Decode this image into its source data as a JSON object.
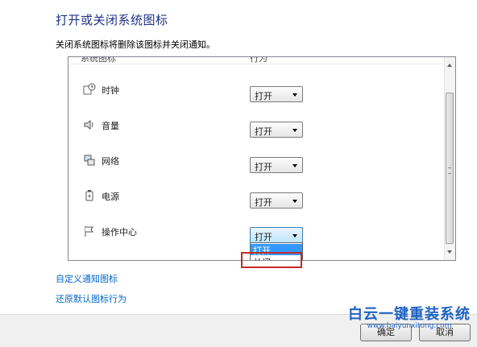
{
  "page": {
    "title": "打开或关闭系统图标",
    "description": "关闭系统图标将删除该图标并关闭通知。"
  },
  "table": {
    "headers": {
      "icon": "系统图标",
      "behavior": "行为"
    },
    "rows": [
      {
        "name": "时钟",
        "icon": "clock-icon",
        "value": "打开"
      },
      {
        "name": "音量",
        "icon": "speaker-icon",
        "value": "打开"
      },
      {
        "name": "网络",
        "icon": "network-icon",
        "value": "打开"
      },
      {
        "name": "电源",
        "icon": "power-icon",
        "value": "打开"
      },
      {
        "name": "操作中心",
        "icon": "flag-icon",
        "value": "打开"
      }
    ]
  },
  "dropdown": {
    "options": [
      "打开",
      "关闭"
    ],
    "selected": "打开"
  },
  "links": {
    "customize": "自定义通知图标",
    "restore": "还原默认图标行为"
  },
  "buttons": {
    "ok": "确定",
    "cancel": "取消"
  },
  "watermark": {
    "title": "白云一键重装系统",
    "url": "www.baiyunxitong.com"
  },
  "colors": {
    "title": "#1e3287",
    "link": "#0066cc",
    "highlight": "#c62828",
    "selection": "#3399ff"
  }
}
